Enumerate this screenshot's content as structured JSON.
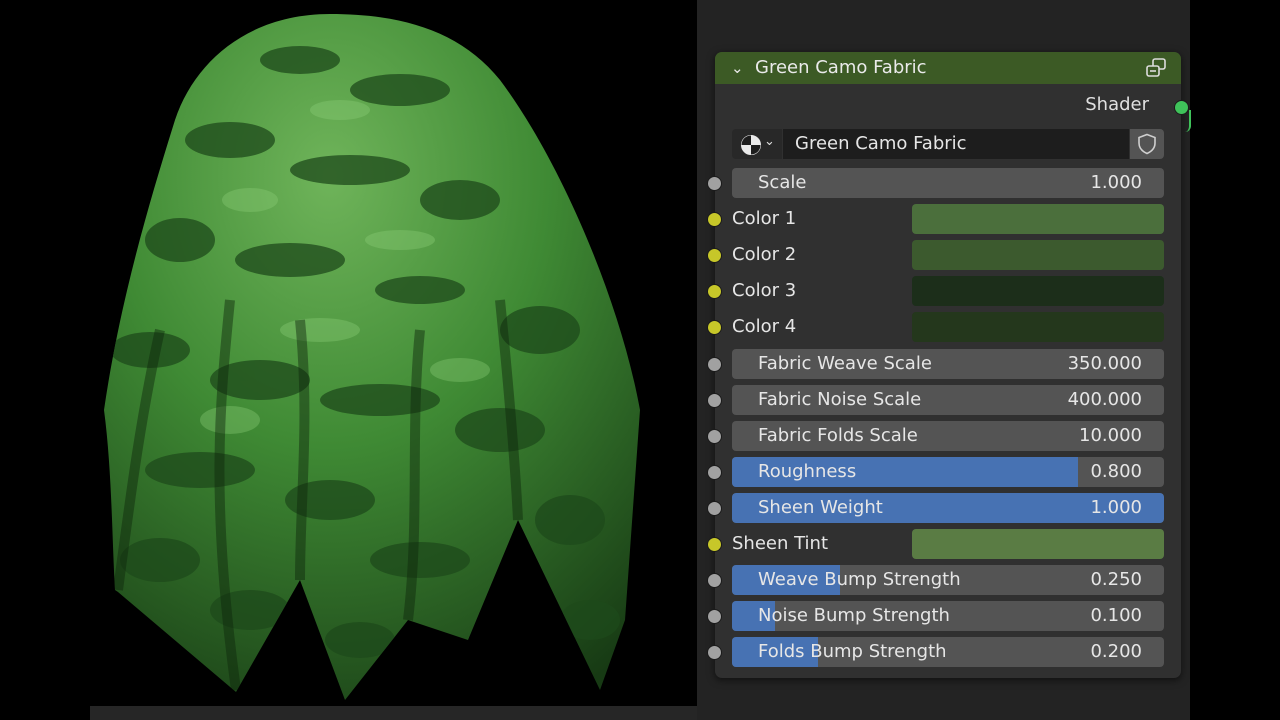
{
  "node": {
    "title": "Green Camo Fabric",
    "output_label": "Shader",
    "datablock_name": "Green Camo Fabric",
    "icons": {
      "collapse": "chevron-down-icon",
      "node_group": "node-group-icon",
      "material": "material-sphere-icon",
      "fake_user": "shield-icon"
    },
    "colors": {
      "header": "#3c5a25",
      "output_socket": "#3fc25a",
      "slider_fill": "#4772b3"
    },
    "sliders": [
      {
        "label": "Scale",
        "value": "1.000"
      },
      {
        "label": "Fabric Weave Scale",
        "value": "350.000"
      },
      {
        "label": "Fabric Noise Scale",
        "value": "400.000"
      },
      {
        "label": "Fabric Folds Scale",
        "value": "10.000"
      },
      {
        "label": "Roughness",
        "value": "0.800",
        "factor": 0.8
      },
      {
        "label": "Sheen Weight",
        "value": "1.000",
        "factor": 1.0
      },
      {
        "label": "Weave Bump Strength",
        "value": "0.250",
        "factor": 0.25
      },
      {
        "label": "Noise Bump Strength",
        "value": "0.100",
        "factor": 0.1
      },
      {
        "label": "Folds Bump Strength",
        "value": "0.200",
        "factor": 0.2
      }
    ],
    "colors_inputs": [
      {
        "label": "Color 1",
        "color": "#4b6f3c"
      },
      {
        "label": "Color 2",
        "color": "#3c5a2e"
      },
      {
        "label": "Color 3",
        "color": "#1c2e1a"
      },
      {
        "label": "Color 4",
        "color": "#24371c"
      },
      {
        "label": "Sheen Tint",
        "color": "#5a7c44"
      }
    ]
  }
}
